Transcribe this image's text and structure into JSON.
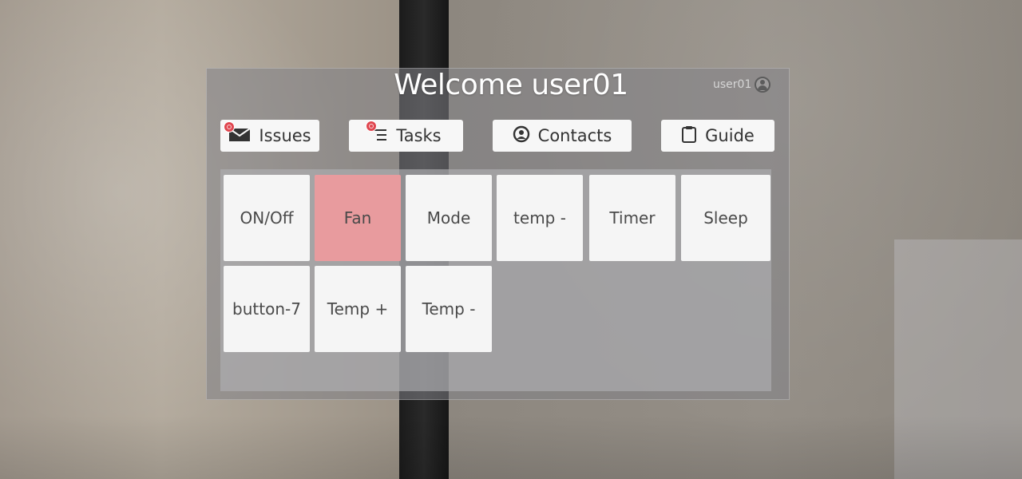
{
  "header": {
    "title": "Welcome user01",
    "username": "user01"
  },
  "nav": [
    {
      "label": "Issues",
      "icon": "mail-icon",
      "badge": true
    },
    {
      "label": "Tasks",
      "icon": "task-list-icon",
      "badge": true
    },
    {
      "label": "Contacts",
      "icon": "contact-icon",
      "badge": false
    },
    {
      "label": "Guide",
      "icon": "clipboard-icon",
      "badge": false
    }
  ],
  "tiles": [
    {
      "label": "ON/Off",
      "active": false
    },
    {
      "label": "Fan",
      "active": true
    },
    {
      "label": "Mode",
      "active": false
    },
    {
      "label": "temp -",
      "active": false
    },
    {
      "label": "Timer",
      "active": false
    },
    {
      "label": "Sleep",
      "active": false
    },
    {
      "label": "button-7",
      "active": false
    },
    {
      "label": "Temp +",
      "active": false
    },
    {
      "label": "Temp -",
      "active": false
    }
  ],
  "colors": {
    "active_tile": "#e89b9e",
    "badge": "#e0464f"
  }
}
